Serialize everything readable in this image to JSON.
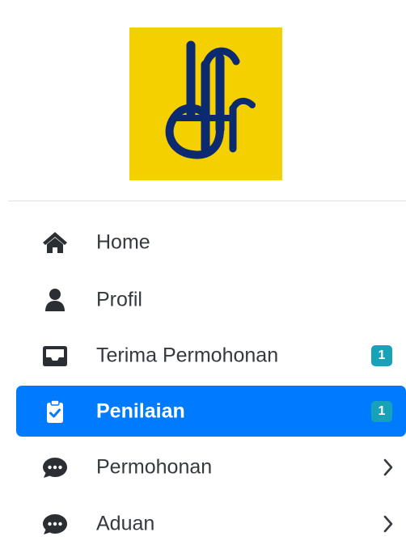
{
  "brand": {
    "logo_text": "ijfr",
    "logo_background": "#f4d000",
    "logo_color": "#0b2a6f"
  },
  "colors": {
    "active_background": "#007bff",
    "badge_background": "#17a2b8",
    "text": "#343a40",
    "active_text": "#ffffff"
  },
  "sidebar": {
    "items": [
      {
        "label": "Home",
        "icon": "home-icon",
        "active": false
      },
      {
        "label": "Profil",
        "icon": "user-icon",
        "active": false
      },
      {
        "label": "Terima Permohonan",
        "icon": "inbox-icon",
        "active": false,
        "badge": "1"
      },
      {
        "label": "Penilaian",
        "icon": "clipboard-check-icon",
        "active": true,
        "badge": "1"
      },
      {
        "label": "Permohonan",
        "icon": "comment-dots-icon",
        "active": false,
        "chevron": "chevron-right-icon"
      },
      {
        "label": "Aduan",
        "icon": "comment-dots-icon",
        "active": false,
        "chevron": "chevron-right-icon"
      }
    ]
  }
}
